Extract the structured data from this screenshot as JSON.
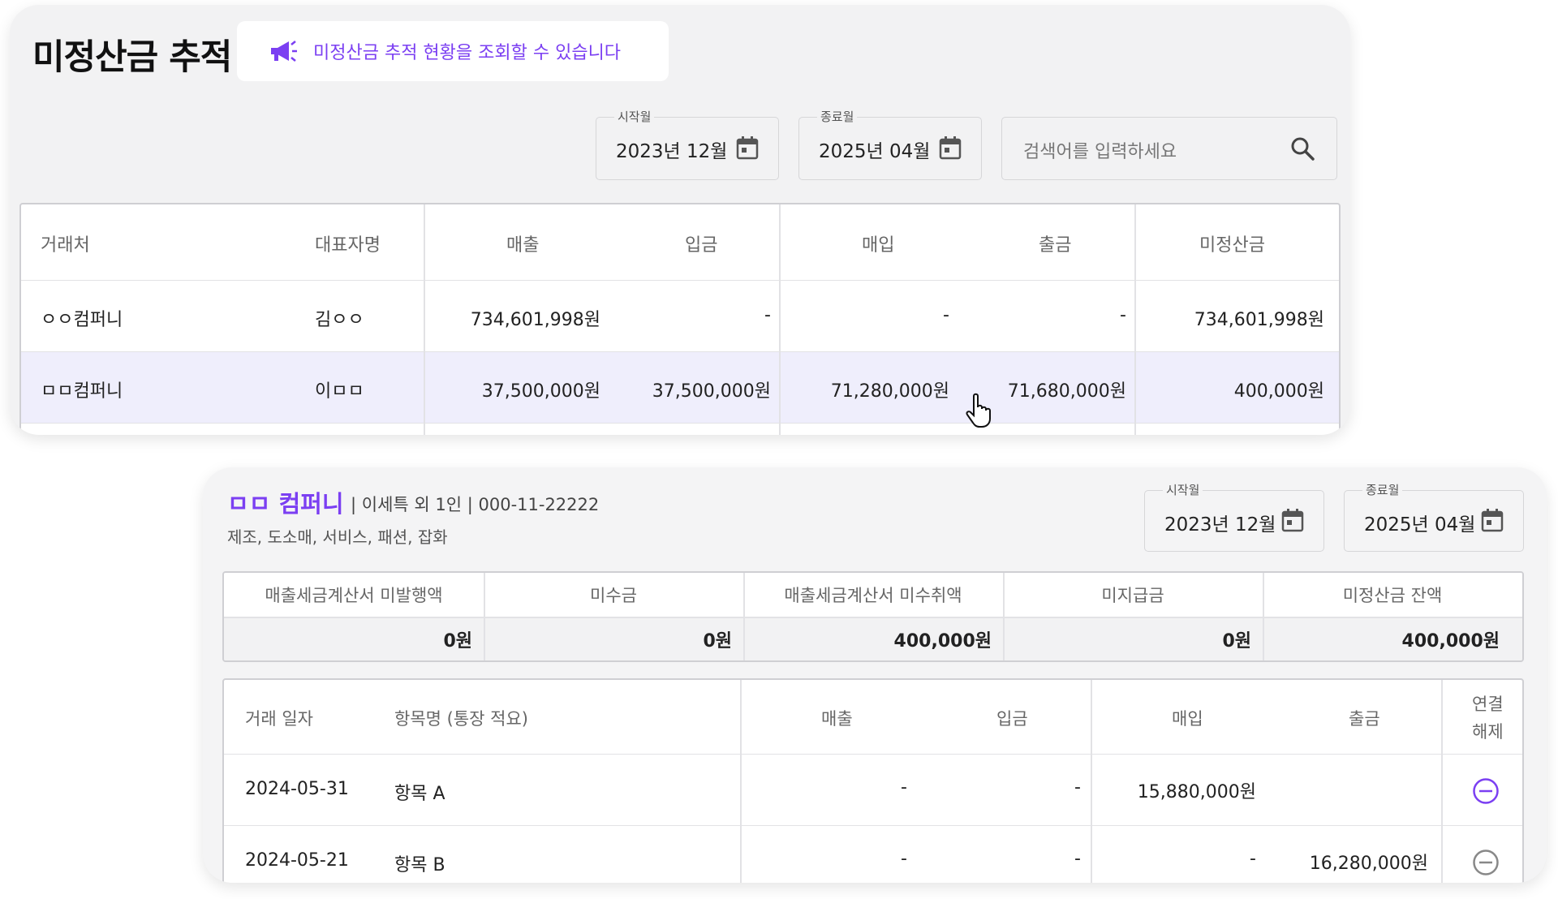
{
  "header": {
    "title": "미정산금 추적",
    "notice": "미정산금 추적 현황을 조회할 수 있습니다"
  },
  "filters": {
    "start_label": "시작월",
    "start_value": "2023년 12월",
    "end_label": "종료월",
    "end_value": "2025년 04월",
    "search_placeholder": "검색어를 입력하세요"
  },
  "partners_table": {
    "headers": [
      "거래처",
      "대표자명",
      "매출",
      "입금",
      "매입",
      "출금",
      "미정산금"
    ],
    "rows": [
      [
        "ㅇㅇ컴퍼니",
        "김ㅇㅇ",
        "734,601,998원",
        "-",
        "-",
        "-",
        "734,601,998원"
      ],
      [
        "ㅁㅁ컴퍼니",
        "이ㅁㅁ",
        "37,500,000원",
        "37,500,000원",
        "71,280,000원",
        "71,680,000원",
        "400,000원"
      ]
    ]
  },
  "detail": {
    "company_name": "ㅁㅁ 컴퍼니",
    "company_meta": "| 이세특 외 1인 | 000-11-22222",
    "categories": "제조, 도소매, 서비스, 패션, 잡화",
    "start_label": "시작월",
    "start_value": "2023년 12월",
    "end_label": "종료월",
    "end_value": "2025년 04월",
    "summary": {
      "headers": [
        "매출세금계산서 미발행액",
        "미수금",
        "매출세금계산서 미수취액",
        "미지급금",
        "미정산금 잔액"
      ],
      "values": [
        "0원",
        "0원",
        "400,000원",
        "0원",
        "400,000원"
      ]
    },
    "transactions": {
      "headers": [
        "거래 일자",
        "항목명 (통장 적요)",
        "매출",
        "입금",
        "매입",
        "출금",
        "연결",
        "해제"
      ],
      "rows": [
        [
          "2024-05-31",
          "항목 A",
          "-",
          "-",
          "15,880,000원",
          ""
        ],
        [
          "2024-05-21",
          "항목 B",
          "-",
          "-",
          "-",
          "16,280,000원"
        ]
      ]
    }
  },
  "colors": {
    "accent": "#7b3ff2",
    "highlight_row": "#efeefc",
    "panel_bg": "#f2f2f3"
  },
  "icons": [
    "megaphone-icon",
    "calendar-icon",
    "search-icon",
    "pointer-cursor-icon",
    "unlink-minus-icon"
  ]
}
